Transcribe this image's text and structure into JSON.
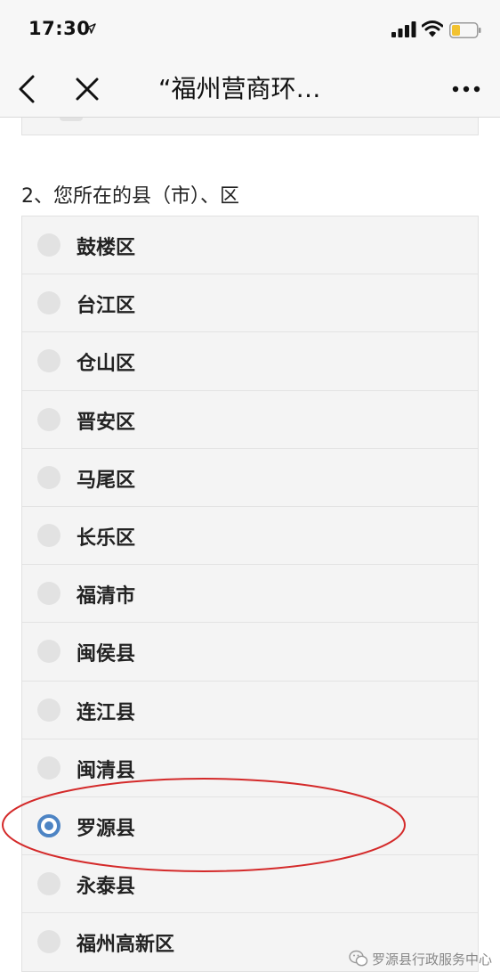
{
  "status_bar": {
    "time": "17:30",
    "battery_color": "#f2c230"
  },
  "nav": {
    "title": "“福州营商环…",
    "back_icon": "chevron-left-icon",
    "close_icon": "close-icon",
    "more_icon": "more-dots-icon"
  },
  "question": {
    "title": "2、您所在的县（市）、区",
    "selected_index": 10,
    "accent_color": "#4d84c4",
    "options": [
      {
        "label": "鼓楼区"
      },
      {
        "label": "台江区"
      },
      {
        "label": "仓山区"
      },
      {
        "label": "晋安区"
      },
      {
        "label": "马尾区"
      },
      {
        "label": "长乐区"
      },
      {
        "label": "福清市"
      },
      {
        "label": "闽侯县"
      },
      {
        "label": "连江县"
      },
      {
        "label": "闽清县"
      },
      {
        "label": "罗源县"
      },
      {
        "label": "永泰县"
      },
      {
        "label": "福州高新区"
      }
    ]
  },
  "annotation": {
    "shape": "ellipse",
    "color": "#d42a2a",
    "highlights_option_index": 10
  },
  "watermark": {
    "text": "罗源县行政服务中心"
  }
}
